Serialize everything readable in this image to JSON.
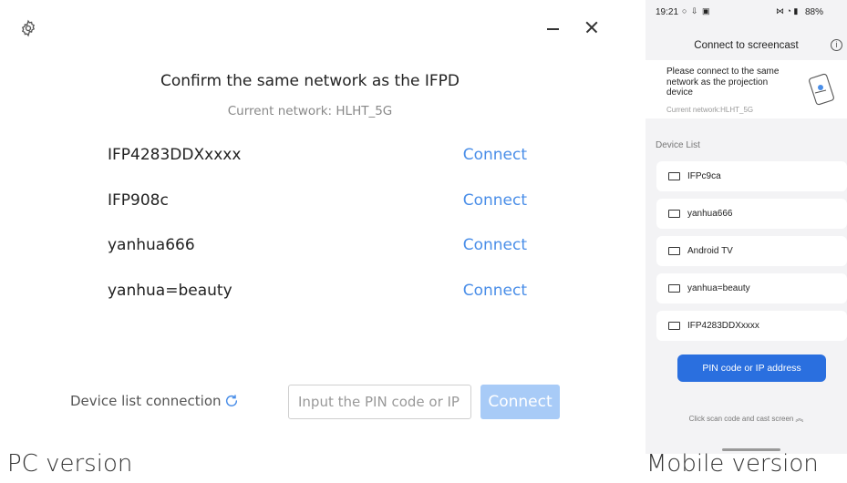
{
  "pc": {
    "title": "Confirm the same network as the IFPD",
    "current_network": "Current network: HLHT_5G",
    "devices": [
      {
        "name": "IFP4283DDXxxxx",
        "action": "Connect"
      },
      {
        "name": "IFP908c",
        "action": "Connect"
      },
      {
        "name": "yanhua666",
        "action": "Connect"
      },
      {
        "name": "yanhua=beauty",
        "action": "Connect"
      }
    ],
    "device_list_connection": "Device list connection",
    "pin_placeholder": "Input the PIN code or IP",
    "connect_button": "Connect",
    "accent_color": "#4a8ee8",
    "icons": [
      "gear-icon",
      "minimize-icon",
      "close-icon",
      "refresh-icon"
    ]
  },
  "mobile": {
    "status_time": "19:21",
    "status_battery": "88%",
    "header_title": "Connect to screencast",
    "banner_text": "Please connect to the same network as the projection device",
    "banner_network": "Current network:HLHT_5G",
    "section_label": "Device List",
    "devices": [
      "IFPc9ca",
      "yanhua666",
      "Android TV",
      "yanhua=beauty",
      "IFP4283DDXxxxx"
    ],
    "pin_button": "PIN code or IP address",
    "scan_text": "Click scan code and cast screen",
    "accent_color": "#2a6fdf"
  },
  "captions": {
    "pc": "PC version",
    "mobile": "Mobile version"
  }
}
